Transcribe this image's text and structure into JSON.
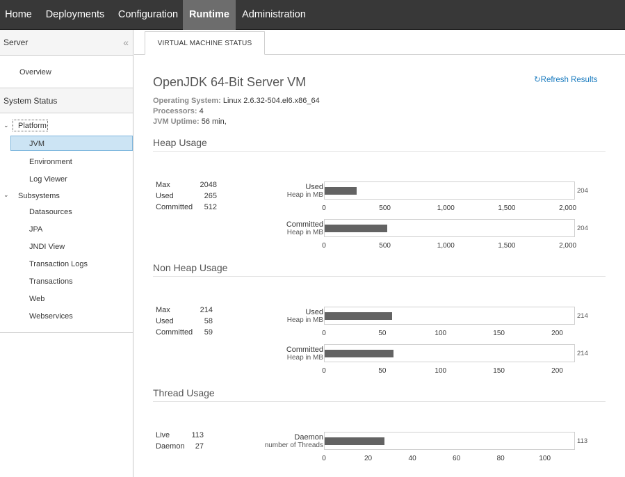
{
  "nav": {
    "tabs": [
      {
        "label": "Home",
        "active": false
      },
      {
        "label": "Deployments",
        "active": false
      },
      {
        "label": "Configuration",
        "active": false
      },
      {
        "label": "Runtime",
        "active": true
      },
      {
        "label": "Administration",
        "active": false
      }
    ]
  },
  "sidebar": {
    "server_header": "Server",
    "collapse_icon": "«",
    "overview": "Overview",
    "system_status_header": "System Status",
    "platform": "Platform",
    "platform_items": [
      "JVM",
      "Environment",
      "Log Viewer"
    ],
    "subsystems": "Subsystems",
    "subsystem_items": [
      "Datasources",
      "JPA",
      "JNDI View",
      "Transaction Logs",
      "Transactions",
      "Web",
      "Webservices"
    ],
    "selected": "JVM"
  },
  "content": {
    "tab": "VIRTUAL MACHINE STATUS",
    "title": "OpenJDK 64-Bit Server VM",
    "refresh": "Refresh Results",
    "os_label": "Operating System:",
    "os_value": "Linux 2.6.32-504.el6.x86_64",
    "proc_label": "Processors:",
    "proc_value": "4",
    "uptime_label": "JVM Uptime:",
    "uptime_value": "56 min,",
    "heap": {
      "title": "Heap Usage",
      "stats": [
        {
          "label": "Max",
          "value": "2048"
        },
        {
          "label": "Used",
          "value": "265"
        },
        {
          "label": "Committed",
          "value": "512"
        }
      ],
      "bars": [
        {
          "label": "Used",
          "sub": "Heap in MB",
          "value": 265,
          "max_label": "204"
        },
        {
          "label": "Committed",
          "sub": "Heap in MB",
          "value": 512,
          "max_label": "204"
        }
      ],
      "axis_max": 2048,
      "ticks": [
        "0",
        "500",
        "1,000",
        "1,500",
        "2,000"
      ],
      "tick_values": [
        0,
        500,
        1000,
        1500,
        2000
      ]
    },
    "nonheap": {
      "title": "Non Heap Usage",
      "stats": [
        {
          "label": "Max",
          "value": "214"
        },
        {
          "label": "Used",
          "value": "58"
        },
        {
          "label": "Committed",
          "value": "59"
        }
      ],
      "bars": [
        {
          "label": "Used",
          "sub": "Heap in MB",
          "value": 58,
          "max_label": "214"
        },
        {
          "label": "Committed",
          "sub": "Heap in MB",
          "value": 59,
          "max_label": "214"
        }
      ],
      "axis_max": 214,
      "ticks": [
        "0",
        "50",
        "100",
        "150",
        "200"
      ],
      "tick_values": [
        0,
        50,
        100,
        150,
        200
      ]
    },
    "thread": {
      "title": "Thread Usage",
      "stats": [
        {
          "label": "Live",
          "value": "113"
        },
        {
          "label": "Daemon",
          "value": "27"
        }
      ],
      "bars": [
        {
          "label": "Daemon",
          "sub": "number of Threads",
          "value": 27,
          "max_label": "113"
        }
      ],
      "axis_max": 113,
      "ticks": [
        "0",
        "20",
        "40",
        "60",
        "80",
        "100"
      ],
      "tick_values": [
        0,
        20,
        40,
        60,
        80,
        100
      ]
    }
  }
}
